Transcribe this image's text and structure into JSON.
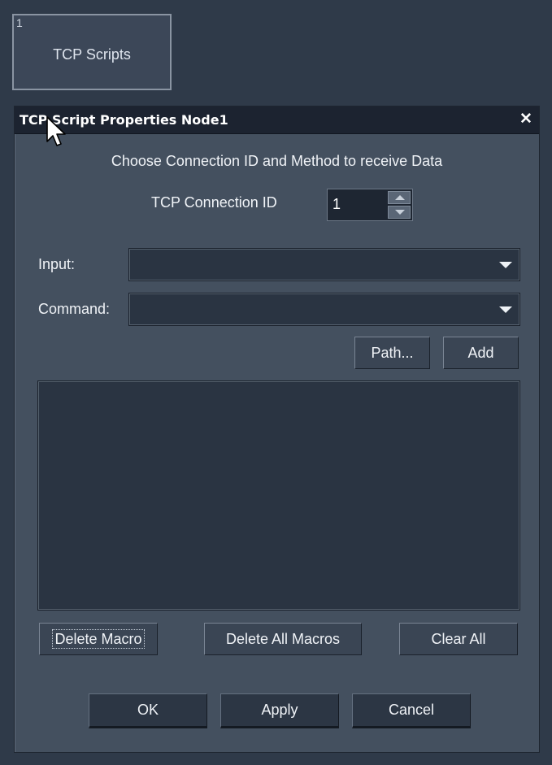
{
  "node": {
    "number": "1",
    "title": "TCP Scripts"
  },
  "dialog": {
    "title": "TCP Script Properties Node1",
    "close_glyph": "✕",
    "instruction": "Choose Connection ID and Method to receive Data",
    "connection": {
      "label": "TCP Connection ID",
      "value": "1"
    },
    "input": {
      "label": "Input:",
      "value": ""
    },
    "command": {
      "label": "Command:",
      "value": ""
    },
    "path_button": "Path...",
    "add_button": "Add",
    "macro_list": [],
    "delete_macro_button": "Delete Macro",
    "delete_all_macros_button": "Delete All Macros",
    "clear_all_button": "Clear All",
    "ok_button": "OK",
    "apply_button": "Apply",
    "cancel_button": "Cancel"
  },
  "icons": {
    "close": "close-icon",
    "spin_up": "chevron-up-icon",
    "spin_down": "chevron-down-icon",
    "combo": "chevron-down-icon",
    "cursor": "mouse-pointer-icon"
  },
  "colors": {
    "background": "#2f3a49",
    "dialog": "#44505f",
    "titlebar": "#1c2330",
    "field": "#2a3442",
    "text": "#f0f3f7"
  }
}
